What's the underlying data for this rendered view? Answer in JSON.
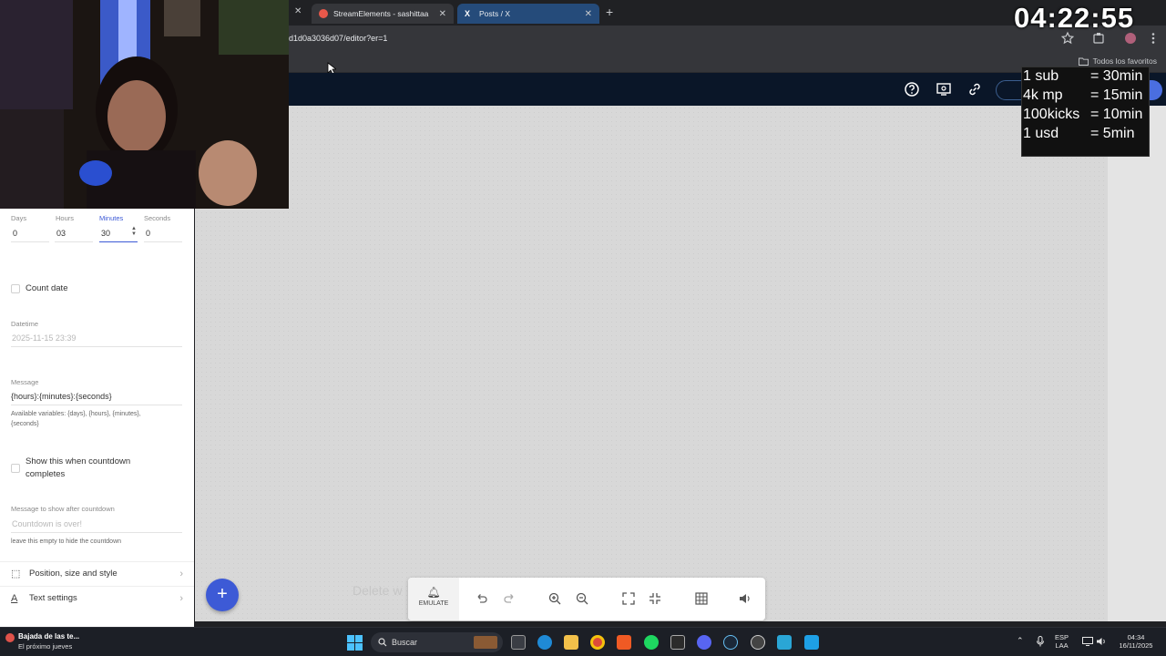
{
  "browser": {
    "tabs": [
      {
        "title": "StreamElements - sashittaa",
        "active": false
      },
      {
        "title": "Posts / X",
        "active": true
      }
    ],
    "url": "d1d0a3036d07/editor?er=1",
    "bookmarks_label": "Todos los favoritos"
  },
  "countdown_settings": {
    "duration": {
      "labels": [
        "Days",
        "Hours",
        "Minutes",
        "Seconds"
      ],
      "values": [
        "0",
        "03",
        "30",
        "0"
      ],
      "focused": "Minutes"
    },
    "count_date_label": "Count date",
    "datetime_label": "Datetime",
    "datetime_value": "2025-11-15 23:39",
    "message_label": "Message",
    "message_value": "{hours}:{minutes}:{seconds}",
    "message_hint": "Available variables: {days}, {hours}, {minutes}, {seconds}",
    "show_complete_label": "Show this when countdown completes",
    "after_message_label": "Message to show after countdown",
    "after_message_placeholder": "Countdown is over!",
    "after_message_hint": "leave this empty to hide the countdown",
    "sections": [
      "Position, size and style",
      "Text settings"
    ]
  },
  "canvas": {
    "ghost_text": "Delete w"
  },
  "toolbar": {
    "emulate_label": "EMULATE"
  },
  "overlay": {
    "timer": "04:22:55",
    "rates": [
      {
        "item": "1 sub",
        "value": "= 30min"
      },
      {
        "item": "4k mp",
        "value": "= 15min"
      },
      {
        "item": "100kicks",
        "value": "= 10min"
      },
      {
        "item": "1 usd",
        "value": "=  5min"
      }
    ]
  },
  "taskbar": {
    "news_title": "Bajada de las te...",
    "news_subtitle": "El próximo jueves",
    "search_label": "Buscar",
    "language_line1": "ESP",
    "language_line2": "LAA",
    "time": "04:34",
    "date": "16/11/2025"
  },
  "colors": {
    "header_bg": "#0a1628",
    "accent_blue": "#3d5ad6",
    "canvas_bg": "#d8d8d8",
    "taskbar_bg": "#1c1f26"
  }
}
